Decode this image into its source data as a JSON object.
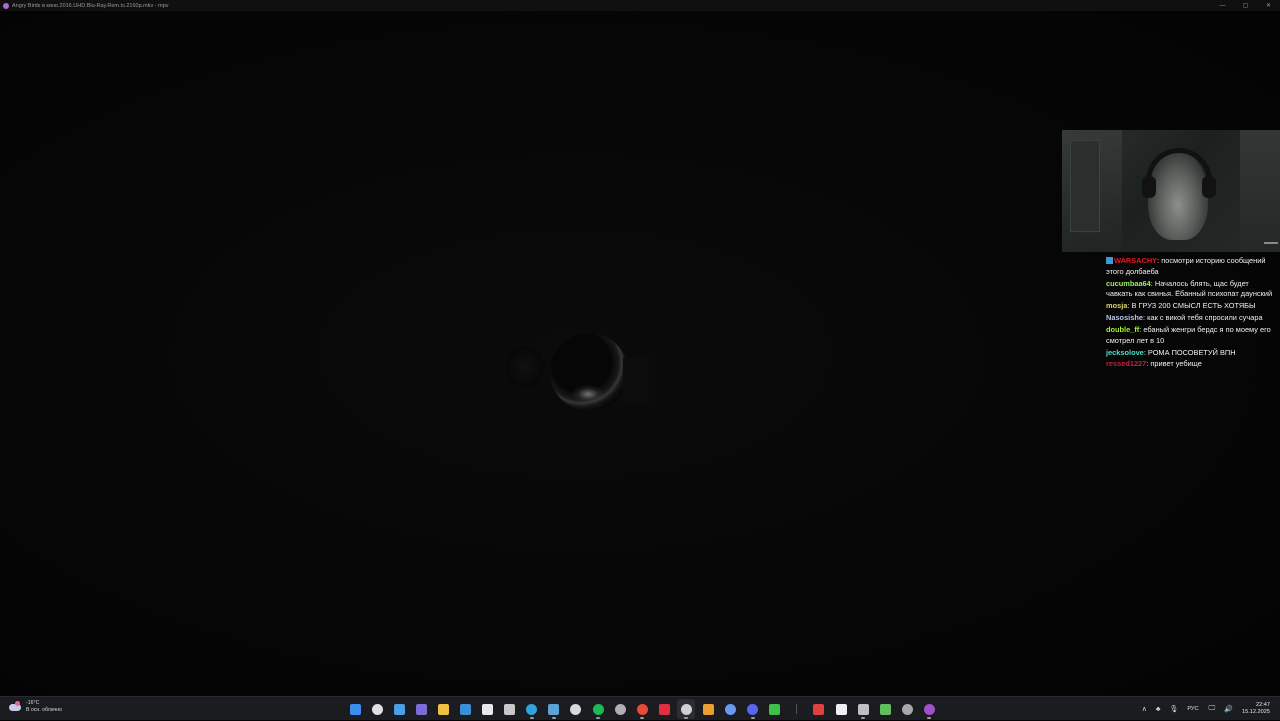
{
  "window": {
    "title": "Angry Birds в кино.2016.UHD.Blu-Ray.Rem.ts.2160p.mkv - mpv",
    "controls": [
      "—",
      "▢",
      "✕"
    ]
  },
  "chat": {
    "messages": [
      {
        "user": "WARSACHY",
        "separator": ": ",
        "text": "посмотри историю сообщений этого долбаеба",
        "color": "#e01a2a",
        "badge": true
      },
      {
        "user": "cucumbaa64",
        "separator": ": ",
        "text": "Началось блять, щас будет чавкать как свинья. Ёбанный психопат даунский",
        "color": "#9bf25d",
        "badge": false
      },
      {
        "user": "mosja",
        "separator": ": ",
        "text": "В ГРУЗ 200 СМЫСЛ ЕСТЬ ХОТЯБЫ",
        "color": "#d8d86a",
        "badge": false
      },
      {
        "user": "Nasosishe",
        "separator": ": ",
        "text": "как с викой тебя спросили сучара",
        "color": "#b8c8e8",
        "badge": false
      },
      {
        "user": "double_ff",
        "separator": ": ",
        "text": "ебаный женгри бердс я по моему его смотрел лет в 10",
        "color": "#a6f030",
        "badge": false
      },
      {
        "user": "jecksolove",
        "separator": ": ",
        "text": "РОМА ПОСОВЕТУЙ ВПН",
        "color": "#4ce0c8",
        "badge": false
      },
      {
        "user": "ressed1227",
        "separator": ": ",
        "text": "привет уебище",
        "color": "#c4203a",
        "badge": false
      }
    ]
  },
  "taskbar": {
    "weather": {
      "temp": "-16°C",
      "desc": "В осн. облачно"
    },
    "apps": [
      {
        "name": "start-icon",
        "color": "#3a8ef0",
        "shape": "sq",
        "running": false
      },
      {
        "name": "search-icon",
        "color": "#e0e0e0",
        "shape": "circ",
        "running": false
      },
      {
        "name": "widgets-icon",
        "color": "#4a9fe8",
        "shape": "sq",
        "running": false
      },
      {
        "name": "visual-studio-icon",
        "color": "#7b6cd9",
        "shape": "sq",
        "running": false
      },
      {
        "name": "file-explorer-icon",
        "color": "#f0c040",
        "shape": "sq",
        "running": false
      },
      {
        "name": "mail-icon",
        "color": "#3b8fd6",
        "shape": "sq",
        "running": false
      },
      {
        "name": "store-icon",
        "color": "#e8e8e8",
        "shape": "sq",
        "running": false
      },
      {
        "name": "terminal-app-icon",
        "color": "#c8c8c8",
        "shape": "sq",
        "running": false
      },
      {
        "name": "telegram-icon",
        "color": "#2ca5e0",
        "shape": "circ",
        "running": true
      },
      {
        "name": "steam-icon",
        "color": "#5aa2d8",
        "shape": "sq",
        "running": true
      },
      {
        "name": "chatgpt-icon",
        "color": "#d8d8d8",
        "shape": "circ",
        "running": false
      },
      {
        "name": "spotify-icon",
        "color": "#1db954",
        "shape": "circ",
        "running": true
      },
      {
        "name": "settings-gear-icon",
        "color": "#b0b0b0",
        "shape": "circ",
        "running": false
      },
      {
        "name": "chrome-icon",
        "color": "#e84a3a",
        "shape": "circ",
        "running": true
      },
      {
        "name": "app-x-icon",
        "color": "#e03040",
        "shape": "sq",
        "running": false
      },
      {
        "name": "obs-icon",
        "color": "#d0d0d0",
        "shape": "circ",
        "running": true
      },
      {
        "name": "shield-app-icon",
        "color": "#e8a030",
        "shape": "sq",
        "running": false
      },
      {
        "name": "globe-app-icon",
        "color": "#6a9af0",
        "shape": "circ",
        "running": false
      },
      {
        "name": "discord-icon",
        "color": "#5865f2",
        "shape": "circ",
        "running": true
      },
      {
        "name": "xbox-icon",
        "color": "#3ec04a",
        "shape": "sq",
        "running": false
      },
      {
        "name": "divider-icon",
        "color": "#555555",
        "shape": "sq",
        "running": false
      },
      {
        "name": "app-red-icon",
        "color": "#e04040",
        "shape": "sq",
        "running": false
      },
      {
        "name": "hyper-icon",
        "color": "#f0f0f0",
        "shape": "sq",
        "running": false
      },
      {
        "name": "terminal-icon",
        "color": "#c0c0c0",
        "shape": "sq",
        "running": true
      },
      {
        "name": "network-app-icon",
        "color": "#60c060",
        "shape": "sq",
        "running": false
      },
      {
        "name": "gear-icon",
        "color": "#a8a8a8",
        "shape": "circ",
        "running": false
      },
      {
        "name": "mpv-icon",
        "color": "#a050c8",
        "shape": "circ",
        "running": true
      }
    ],
    "tray": {
      "chevron": "∧",
      "glyphs": [
        "♣",
        "🎙",
        "РУС",
        "🖵",
        "🔊"
      ],
      "lang": "РУС",
      "time": "22:47",
      "date": "15.12.2025"
    }
  }
}
